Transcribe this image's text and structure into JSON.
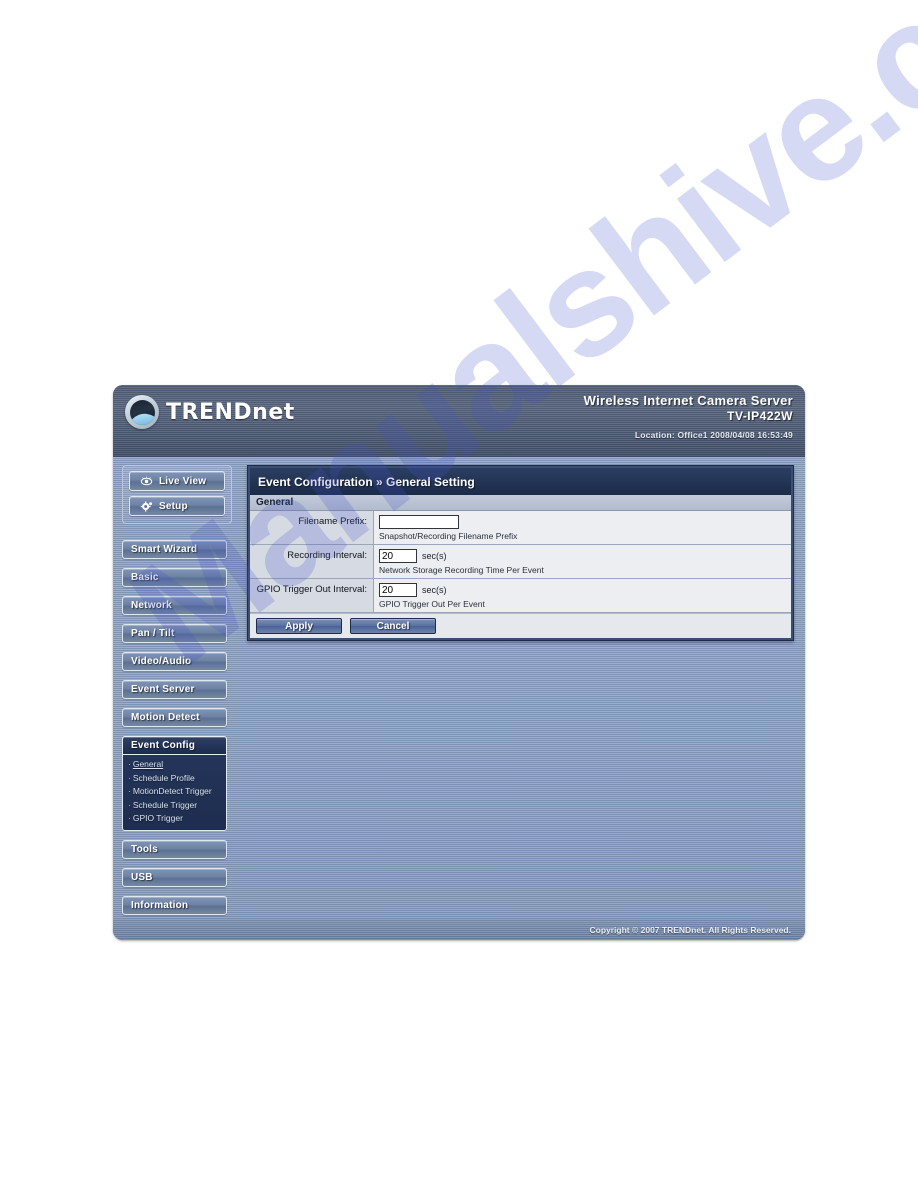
{
  "watermark": {
    "text": "Manualshive.com"
  },
  "banner": {
    "logo_text_upper": "TREND",
    "logo_text_lower": "net",
    "logo_icon": "globe-icon",
    "title": "Wireless Internet Camera Server",
    "model": "TV-IP422W",
    "status": "Location: Office1    2008/04/08 16:53:49"
  },
  "sidebar": {
    "top_buttons": [
      {
        "label": "Live View",
        "icon": "eye-icon"
      },
      {
        "label": "Setup",
        "icon": "gear-icon"
      }
    ],
    "items": [
      {
        "label": "Smart Wizard",
        "active": false
      },
      {
        "label": "Basic",
        "active": false
      },
      {
        "label": "Network",
        "active": false
      },
      {
        "label": "Pan / Tilt",
        "active": false
      },
      {
        "label": "Video/Audio",
        "active": false
      },
      {
        "label": "Event Server",
        "active": false
      },
      {
        "label": "Motion Detect",
        "active": false
      },
      {
        "label": "Event Config",
        "active": true
      }
    ],
    "submenu": [
      {
        "label": "General",
        "active": true
      },
      {
        "label": "Schedule Profile",
        "active": false
      },
      {
        "label": "MotionDetect Trigger",
        "active": false
      },
      {
        "label": "Schedule Trigger",
        "active": false
      },
      {
        "label": "GPIO Trigger",
        "active": false
      }
    ],
    "items_bottom": [
      {
        "label": "Tools"
      },
      {
        "label": "USB"
      },
      {
        "label": "Information"
      }
    ]
  },
  "content": {
    "title": "Event Configuration » General Setting",
    "section_header": "General",
    "rows": [
      {
        "label": "Filename Prefix:",
        "value": "",
        "unit": "",
        "hint": "Snapshot/Recording Filename Prefix"
      },
      {
        "label": "Recording Interval:",
        "value": "20",
        "unit": "sec(s)",
        "hint": "Network Storage Recording Time Per Event"
      },
      {
        "label": "GPIO Trigger Out Interval:",
        "value": "20",
        "unit": "sec(s)",
        "hint": "GPIO Trigger Out Per Event"
      }
    ],
    "apply_label": "Apply",
    "cancel_label": "Cancel"
  },
  "footer": {
    "copyright": "Copyright © 2007 TRENDnet. All Rights Reserved."
  },
  "colors": {
    "shell": "#2a2f38",
    "banner": "#4e5c74",
    "body_blue": "#8ea2c0",
    "title_bar": "#223454",
    "accent": "#5a70a0"
  }
}
